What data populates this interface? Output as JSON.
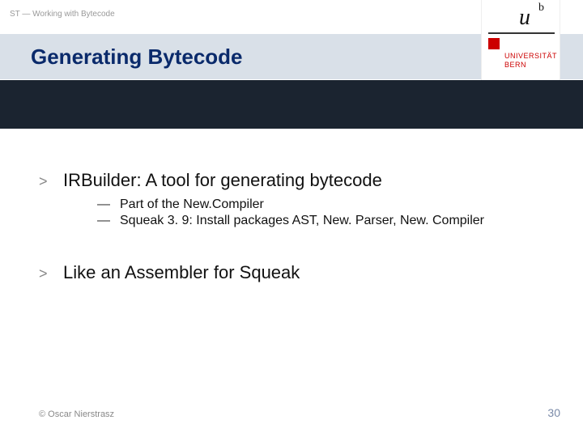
{
  "breadcrumb": "ST — Working with Bytecode",
  "title": "Generating Bytecode",
  "logo": {
    "u": "u",
    "b": "b",
    "line1": "UNIVERSITÄT",
    "line2": "BERN"
  },
  "bullets": [
    {
      "marker": ">",
      "text": "IRBuilder: A tool for generating bytecode",
      "sub": [
        {
          "marker": "—",
          "text": "Part of the New.Compiler"
        },
        {
          "marker": "—",
          "text": "Squeak 3. 9: Install packages AST, New. Parser, New. Compiler"
        }
      ]
    },
    {
      "marker": ">",
      "text": "Like an Assembler for Squeak",
      "sub": []
    }
  ],
  "footer": {
    "copyright": "© Oscar Nierstrasz",
    "page": "30"
  }
}
